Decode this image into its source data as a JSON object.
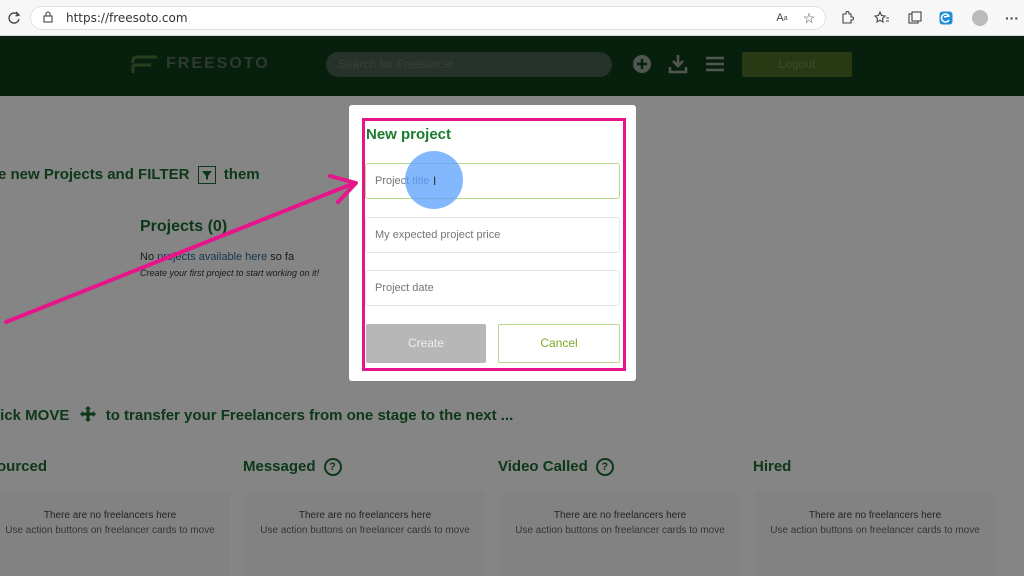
{
  "browser": {
    "url": "https://freesoto.com",
    "icons": [
      "reload-icon",
      "lock-icon",
      "read-aloud-icon",
      "favorite-star-icon",
      "extensions-icon",
      "favorites-icon",
      "collections-icon",
      "edge-icon",
      "profile-avatar-icon",
      "more-icon"
    ]
  },
  "header": {
    "logo_text": "FREESOTO",
    "search_placeholder": "Search for Freelancer",
    "logout_label": "Logout",
    "icons": [
      "add-circle-icon",
      "download-icon",
      "menu-icon"
    ]
  },
  "page": {
    "line1_prefix": "e new Projects and FILTER",
    "line1_suffix": "them",
    "projects_title": "Projects (0)",
    "no_projects_a": "No ",
    "no_projects_link": "projects available here",
    "no_projects_b": " so fa",
    "create_first": "Create your first project to start working on it!",
    "move_prefix": "lick MOVE",
    "move_suffix": "to transfer your Freelancers from one stage to the next ...",
    "stages": [
      {
        "label": "ourced",
        "empty_title": "There are no freelancers here",
        "empty_sub": "Use action buttons on freelancer cards to move"
      },
      {
        "label": "Messaged",
        "empty_title": "There are no freelancers here",
        "empty_sub": "Use action buttons on freelancer cards to move"
      },
      {
        "label": "Video Called",
        "empty_title": "There are no freelancers here",
        "empty_sub": "Use action buttons on freelancer cards to move"
      },
      {
        "label": "Hired",
        "empty_title": "There are no freelancers here",
        "empty_sub": "Use action buttons on freelancer cards to move"
      }
    ],
    "help_glyph": "?"
  },
  "modal": {
    "title": "New project",
    "fields": [
      {
        "placeholder": "Project title"
      },
      {
        "placeholder": "My expected project price"
      },
      {
        "placeholder": "Project date"
      }
    ],
    "create_label": "Create",
    "cancel_label": "Cancel"
  },
  "colors": {
    "brand_dark": "#0e3e1a",
    "brand_green": "#1a7a2e",
    "annotation_pink": "#e6168a",
    "click_blue": "#5aa0ff"
  }
}
